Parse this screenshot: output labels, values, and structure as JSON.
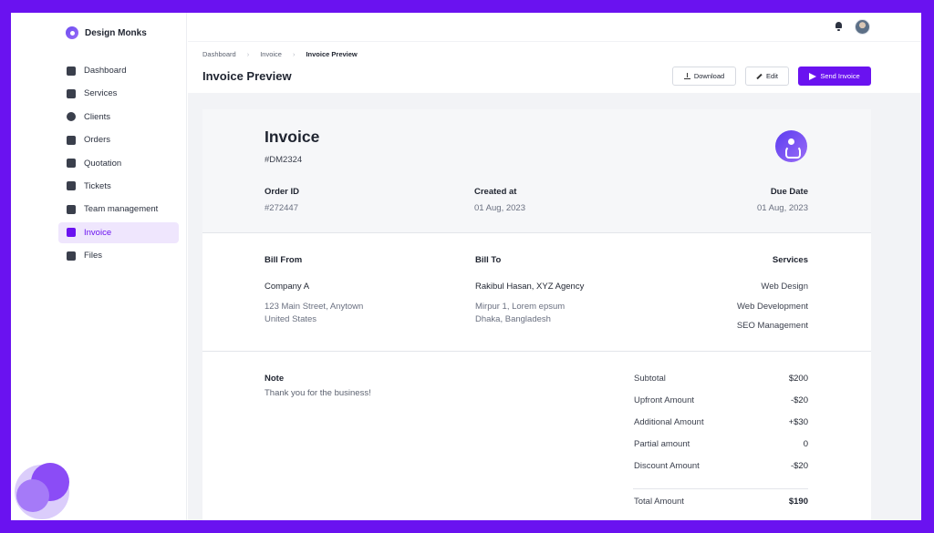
{
  "brand": {
    "name": "Design Monks",
    "icon": "brand-logo-icon"
  },
  "sidebar": {
    "items": [
      {
        "label": "Dashboard",
        "icon": "dashboard-icon"
      },
      {
        "label": "Services",
        "icon": "box-icon"
      },
      {
        "label": "Clients",
        "icon": "clients-icon"
      },
      {
        "label": "Orders",
        "icon": "orders-icon"
      },
      {
        "label": "Quotation",
        "icon": "quotation-icon"
      },
      {
        "label": "Tickets",
        "icon": "ticket-icon"
      },
      {
        "label": "Team management",
        "icon": "team-icon"
      },
      {
        "label": "Invoice",
        "icon": "invoice-icon",
        "active": true
      },
      {
        "label": "Files",
        "icon": "folder-icon"
      }
    ]
  },
  "topbar": {
    "bell_icon": "bell-icon",
    "avatar": "user-avatar"
  },
  "breadcrumb": {
    "items": [
      "Dashboard",
      "Invoice",
      "Invoice Preview"
    ]
  },
  "page": {
    "title": "Invoice Preview"
  },
  "actions": {
    "download": "Download",
    "edit": "Edit",
    "send": "Send Invoice"
  },
  "invoice": {
    "title": "Invoice",
    "number": "#DM2324",
    "order_id_label": "Order ID",
    "order_id": "#272447",
    "created_label": "Created at",
    "created": "01 Aug, 2023",
    "due_label": "Due Date",
    "due": "01 Aug, 2023",
    "bill_from": {
      "label": "Bill From",
      "name": "Company A",
      "address1": "123 Main Street, Anytown",
      "address2": "United States"
    },
    "bill_to": {
      "label": "Bill To",
      "name": "Rakibul Hasan, XYZ Agency",
      "address1": "Mirpur 1, Lorem epsum",
      "address2": "Dhaka, Bangladesh"
    },
    "services": {
      "label": "Services",
      "items": [
        "Web Design",
        "Web Development",
        "SEO Management"
      ]
    },
    "note": {
      "label": "Note",
      "text": "Thank you for the business!"
    },
    "summary": [
      {
        "label": "Subtotal",
        "value": "$200"
      },
      {
        "label": "Upfront Amount",
        "value": "-$20"
      },
      {
        "label": "Additional Amount",
        "value": "+$30"
      },
      {
        "label": "Partial amount",
        "value": "0"
      },
      {
        "label": "Discount Amount",
        "value": "-$20"
      }
    ],
    "total": {
      "label": "Total Amount",
      "value": "$190"
    }
  },
  "colors": {
    "accent": "#6a12f0",
    "frame": "#6a12f0",
    "active_bg": "#efe6fd"
  }
}
